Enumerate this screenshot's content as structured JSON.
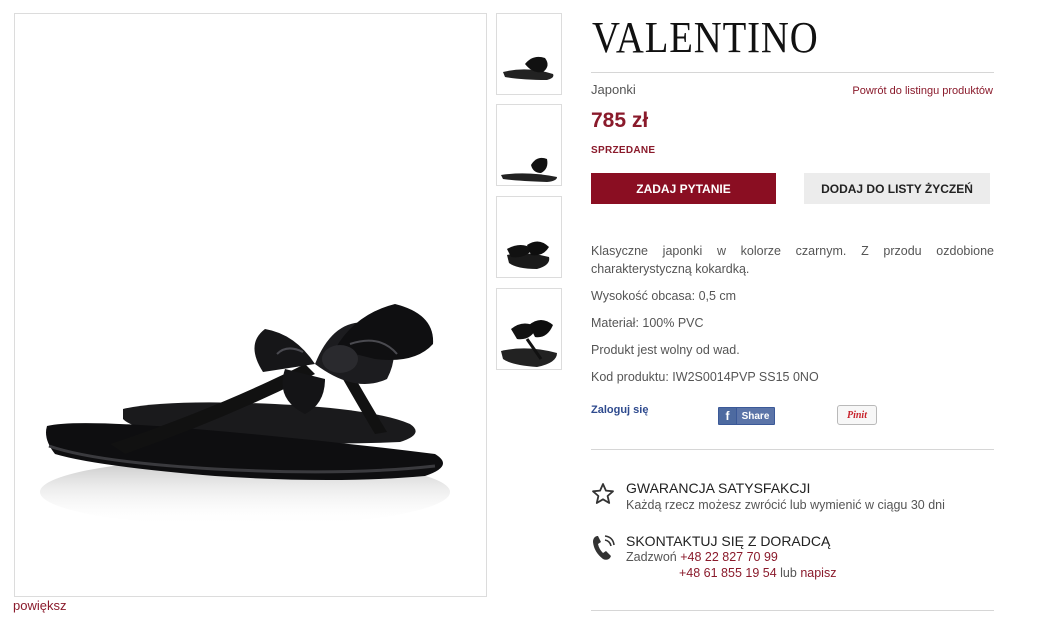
{
  "product": {
    "brand": "VALENTINO",
    "category": "Japonki",
    "back_link": "Powrót do listingu produktów",
    "price": "785 zł",
    "status": "SPRZEDANE",
    "zoom_label": "powiększ"
  },
  "actions": {
    "ask_label": "ZADAJ PYTANIE",
    "wishlist_label": "DODAJ DO LISTY ŻYCZEŃ"
  },
  "details": {
    "description": "Klasyczne japonki w kolorze czarnym. Z przodu ozdobione charakterystyczną kokardką.",
    "heel": "Wysokość obcasa: 0,5 cm",
    "material": "Materiał: 100% PVC",
    "condition": "Produkt jest wolny od wad.",
    "code": "Kod produktu: IW2S0014PVP SS15 0NO"
  },
  "social": {
    "login_label": "Zaloguj się",
    "fb_label": "Share",
    "pin_label": "Pinit"
  },
  "guarantee": {
    "title": "GWARANCJA SATYSFAKCJI",
    "text": "Każdą rzecz możesz zwrócić lub wymienić w ciągu 30 dni",
    "icon": "star-icon"
  },
  "contact": {
    "title": "SKONTAKTUJ SIĘ Z DORADCĄ",
    "call_label": "Zadzwoń",
    "phone1": "+48 22 827 70 99",
    "phone2": "+48 61 855 19 54",
    "or_label": "lub",
    "write_label": "napisz",
    "icon": "phone-icon"
  },
  "colors": {
    "accent": "#8a0e22",
    "link": "#8a1a2b",
    "button_secondary": "#ececec"
  }
}
